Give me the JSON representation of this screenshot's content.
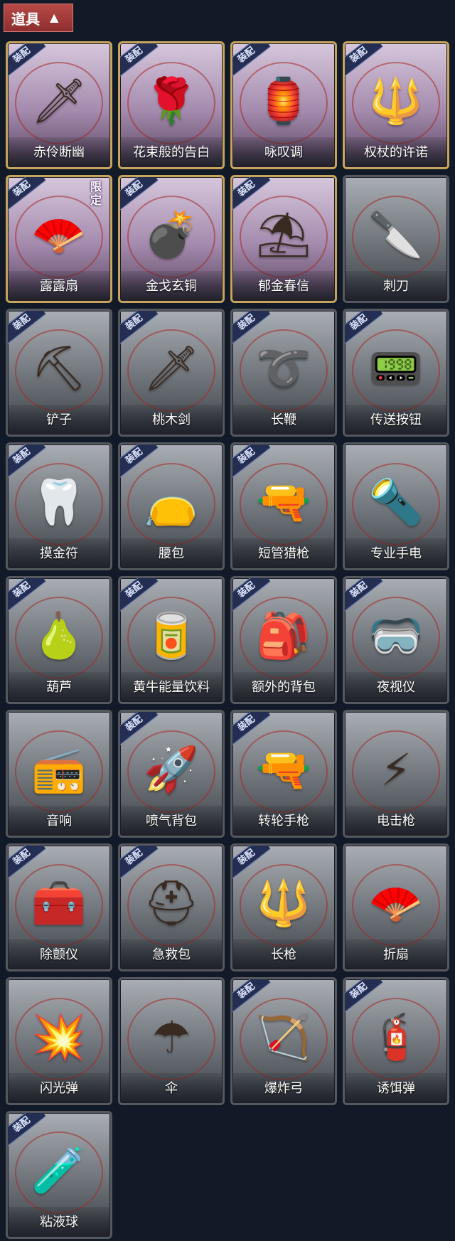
{
  "header": {
    "label": "道具",
    "icon": "chevron-up-icon"
  },
  "equip_badge_label": "装配",
  "items": [
    {
      "label": "赤伶断幽",
      "equipped": true,
      "icon": "dagger-icon",
      "glyph": "🗡",
      "style": "purple"
    },
    {
      "label": "花束般的告白",
      "equipped": true,
      "icon": "rose-icon",
      "glyph": "🌹",
      "style": "purple"
    },
    {
      "label": "咏叹调",
      "equipped": true,
      "icon": "ornate-lantern-icon",
      "glyph": "🏮",
      "style": "purple"
    },
    {
      "label": "权杖的许诺",
      "equipped": true,
      "icon": "scepter-icon",
      "glyph": "🔱",
      "style": "purple"
    },
    {
      "label": "露露扇",
      "equipped": true,
      "icon": "character-fan-icon",
      "glyph": "🪭",
      "style": "purple",
      "limited": "限定"
    },
    {
      "label": "金戈玄铜",
      "equipped": true,
      "icon": "bronze-grenade-icon",
      "glyph": "💣",
      "style": "purple"
    },
    {
      "label": "郁金春信",
      "equipped": true,
      "icon": "paper-umbrella-icon",
      "glyph": "⛱",
      "style": "purple"
    },
    {
      "label": "刺刀",
      "equipped": false,
      "icon": "bayonet-icon",
      "glyph": "🔪",
      "style": "gray"
    },
    {
      "label": "铲子",
      "equipped": true,
      "icon": "shovel-icon",
      "glyph": "⛏",
      "style": "gray"
    },
    {
      "label": "桃木剑",
      "equipped": true,
      "icon": "wooden-sword-icon",
      "glyph": "🗡",
      "style": "gray"
    },
    {
      "label": "长鞭",
      "equipped": true,
      "icon": "whip-icon",
      "glyph": "➰",
      "style": "gray"
    },
    {
      "label": "传送按钮",
      "equipped": true,
      "icon": "teleport-button-icon",
      "glyph": "📟",
      "style": "gray"
    },
    {
      "label": "摸金符",
      "equipped": true,
      "icon": "amulet-icon",
      "glyph": "🦷",
      "style": "gray"
    },
    {
      "label": "腰包",
      "equipped": true,
      "icon": "waist-bag-icon",
      "glyph": "👝",
      "style": "gray"
    },
    {
      "label": "短管猎枪",
      "equipped": true,
      "icon": "shotgun-icon",
      "glyph": "🔫",
      "style": "gray"
    },
    {
      "label": "专业手电",
      "equipped": false,
      "icon": "flashlight-icon",
      "glyph": "🔦",
      "style": "gray"
    },
    {
      "label": "葫芦",
      "equipped": true,
      "icon": "gourd-icon",
      "glyph": "🍐",
      "style": "gray"
    },
    {
      "label": "黄牛能量饮料",
      "equipped": true,
      "icon": "energy-drink-icon",
      "glyph": "🥫",
      "style": "gray"
    },
    {
      "label": "额外的背包",
      "equipped": true,
      "icon": "backpack-icon",
      "glyph": "🎒",
      "style": "gray"
    },
    {
      "label": "夜视仪",
      "equipped": true,
      "icon": "night-vision-icon",
      "glyph": "🥽",
      "style": "gray"
    },
    {
      "label": "音响",
      "equipped": false,
      "icon": "radio-speaker-icon",
      "glyph": "📻",
      "style": "gray"
    },
    {
      "label": "喷气背包",
      "equipped": true,
      "icon": "jetpack-icon",
      "glyph": "🚀",
      "style": "gray"
    },
    {
      "label": "转轮手枪",
      "equipped": true,
      "icon": "revolver-icon",
      "glyph": "🔫",
      "style": "gray"
    },
    {
      "label": "电击枪",
      "equipped": false,
      "icon": "shock-gun-icon",
      "glyph": "⚡",
      "style": "gray"
    },
    {
      "label": "除颤仪",
      "equipped": true,
      "icon": "defibrillator-icon",
      "glyph": "🧰",
      "style": "gray"
    },
    {
      "label": "急救包",
      "equipped": true,
      "icon": "first-aid-kit-icon",
      "glyph": "⛑",
      "style": "gray"
    },
    {
      "label": "长枪",
      "equipped": true,
      "icon": "spear-icon",
      "glyph": "🔱",
      "style": "gray"
    },
    {
      "label": "折扇",
      "equipped": false,
      "icon": "folding-fan-icon",
      "glyph": "🪭",
      "style": "gray"
    },
    {
      "label": "闪光弹",
      "equipped": false,
      "icon": "flashbang-icon",
      "glyph": "💥",
      "style": "gray"
    },
    {
      "label": "伞",
      "equipped": false,
      "icon": "umbrella-icon",
      "glyph": "☂",
      "style": "gray"
    },
    {
      "label": "爆炸弓",
      "equipped": true,
      "icon": "bow-icon",
      "glyph": "🏹",
      "style": "gray"
    },
    {
      "label": "诱饵弹",
      "equipped": true,
      "icon": "decoy-canister-icon",
      "glyph": "🧯",
      "style": "gray"
    },
    {
      "label": "粘液球",
      "equipped": true,
      "icon": "slime-capsule-icon",
      "glyph": "🧪",
      "style": "gray"
    }
  ]
}
